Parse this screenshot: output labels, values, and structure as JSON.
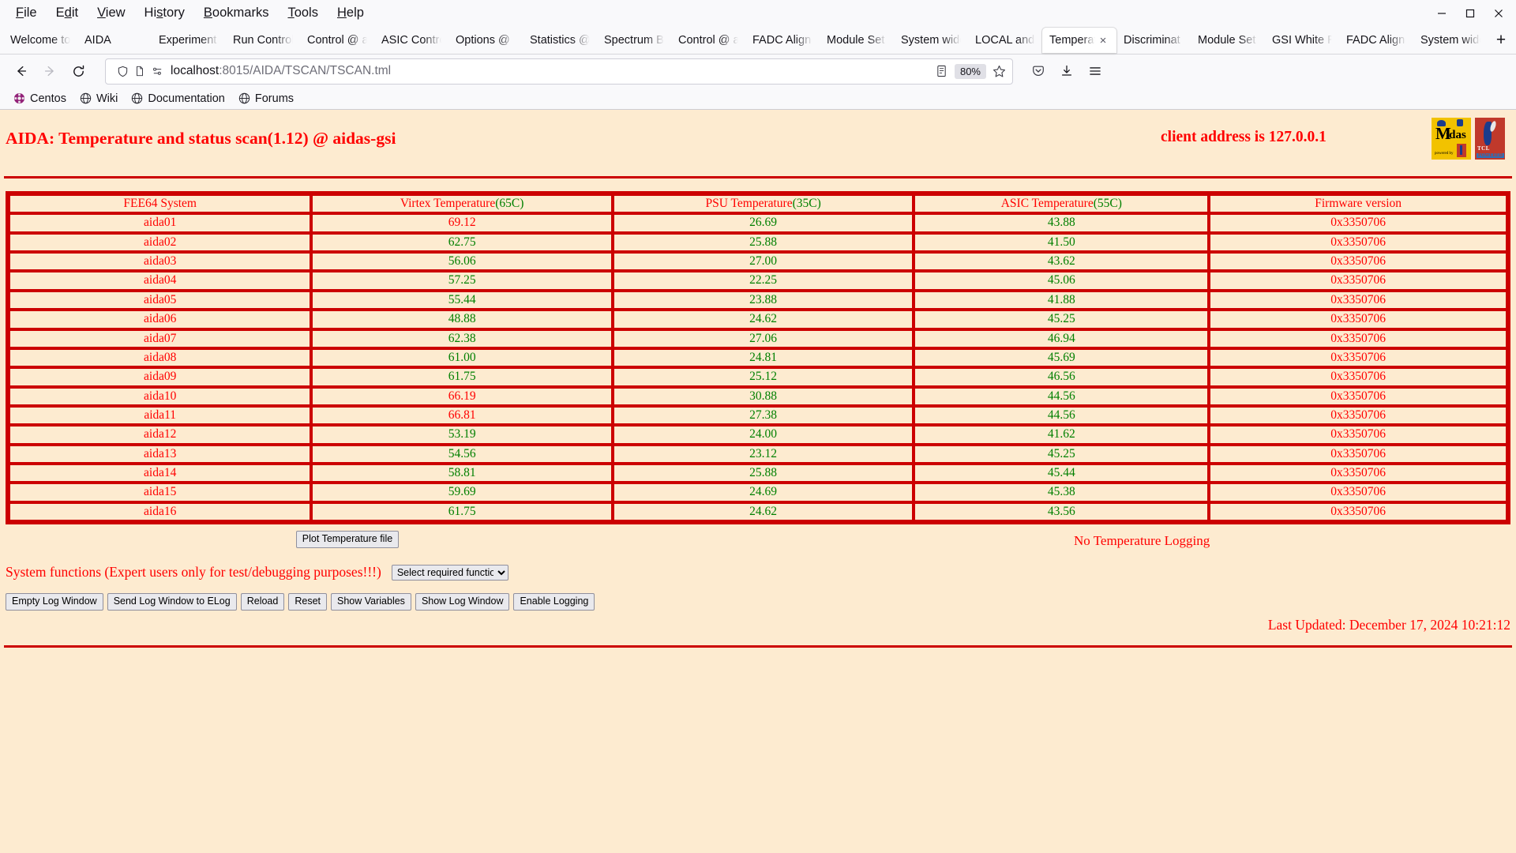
{
  "browser": {
    "menus": [
      "File",
      "Edit",
      "View",
      "History",
      "Bookmarks",
      "Tools",
      "Help"
    ],
    "window_controls": {
      "minimize": "minimize-icon",
      "maximize": "maximize-icon",
      "close": "close-icon"
    },
    "tabs": [
      {
        "label": "Welcome to Firefox",
        "active": false
      },
      {
        "label": "AIDA",
        "active": false
      },
      {
        "label": "Experiment",
        "active": false
      },
      {
        "label": "Run Control @",
        "active": false
      },
      {
        "label": "Control @ aidas",
        "active": false
      },
      {
        "label": "ASIC Control",
        "active": false
      },
      {
        "label": "Options @",
        "active": false
      },
      {
        "label": "Statistics @",
        "active": false
      },
      {
        "label": "Spectrum B",
        "active": false
      },
      {
        "label": "Control @ a",
        "active": false
      },
      {
        "label": "FADC Align",
        "active": false
      },
      {
        "label": "Module Set",
        "active": false
      },
      {
        "label": "System wide",
        "active": false
      },
      {
        "label": "LOCAL and",
        "active": false
      },
      {
        "label": "Temperature",
        "active": true
      },
      {
        "label": "Discriminat",
        "active": false
      },
      {
        "label": "Module Set",
        "active": false
      },
      {
        "label": "GSI White R",
        "active": false
      },
      {
        "label": "FADC Align",
        "active": false
      },
      {
        "label": "System wide",
        "active": false
      }
    ],
    "new_tab_label": "+",
    "nav": {
      "back": "back-arrow-icon",
      "forward": "forward-arrow-icon",
      "reload": "reload-icon"
    },
    "url_host": "localhost",
    "url_rest": ":8015/AIDA/TSCAN/TSCAN.tml",
    "zoom_level": "80%",
    "bookmarks": [
      {
        "label": "Centos",
        "icon": "centos-logo-icon"
      },
      {
        "label": "Wiki",
        "icon": "globe-icon"
      },
      {
        "label": "Documentation",
        "icon": "globe-icon"
      },
      {
        "label": "Forums",
        "icon": "globe-icon"
      }
    ]
  },
  "page": {
    "title": "AIDA: Temperature and status scan(1.12) @ aidas-gsi",
    "client_address": "client address is 127.0.0.1",
    "logos": {
      "midas": "midas-logo",
      "tcl": "tcl-powered-logo"
    },
    "table": {
      "headers": [
        {
          "text": "FEE64 System",
          "paren": ""
        },
        {
          "text": "Virtex Temperature",
          "paren": "(65C)"
        },
        {
          "text": "PSU Temperature",
          "paren": "(35C)"
        },
        {
          "text": "ASIC Temperature",
          "paren": "(55C)"
        },
        {
          "text": "Firmware version",
          "paren": ""
        }
      ],
      "rows": [
        {
          "system": "aida01",
          "virtex": "69.12",
          "virtex_hot": true,
          "psu": "26.69",
          "psu_hot": false,
          "asic": "43.88",
          "asic_hot": false,
          "firmware": "0x3350706"
        },
        {
          "system": "aida02",
          "virtex": "62.75",
          "virtex_hot": false,
          "psu": "25.88",
          "psu_hot": false,
          "asic": "41.50",
          "asic_hot": false,
          "firmware": "0x3350706"
        },
        {
          "system": "aida03",
          "virtex": "56.06",
          "virtex_hot": false,
          "psu": "27.00",
          "psu_hot": false,
          "asic": "43.62",
          "asic_hot": false,
          "firmware": "0x3350706"
        },
        {
          "system": "aida04",
          "virtex": "57.25",
          "virtex_hot": false,
          "psu": "22.25",
          "psu_hot": false,
          "asic": "45.06",
          "asic_hot": false,
          "firmware": "0x3350706"
        },
        {
          "system": "aida05",
          "virtex": "55.44",
          "virtex_hot": false,
          "psu": "23.88",
          "psu_hot": false,
          "asic": "41.88",
          "asic_hot": false,
          "firmware": "0x3350706"
        },
        {
          "system": "aida06",
          "virtex": "48.88",
          "virtex_hot": false,
          "psu": "24.62",
          "psu_hot": false,
          "asic": "45.25",
          "asic_hot": false,
          "firmware": "0x3350706"
        },
        {
          "system": "aida07",
          "virtex": "62.38",
          "virtex_hot": false,
          "psu": "27.06",
          "psu_hot": false,
          "asic": "46.94",
          "asic_hot": false,
          "firmware": "0x3350706"
        },
        {
          "system": "aida08",
          "virtex": "61.00",
          "virtex_hot": false,
          "psu": "24.81",
          "psu_hot": false,
          "asic": "45.69",
          "asic_hot": false,
          "firmware": "0x3350706"
        },
        {
          "system": "aida09",
          "virtex": "61.75",
          "virtex_hot": false,
          "psu": "25.12",
          "psu_hot": false,
          "asic": "46.56",
          "asic_hot": false,
          "firmware": "0x3350706"
        },
        {
          "system": "aida10",
          "virtex": "66.19",
          "virtex_hot": true,
          "psu": "30.88",
          "psu_hot": false,
          "asic": "44.56",
          "asic_hot": false,
          "firmware": "0x3350706"
        },
        {
          "system": "aida11",
          "virtex": "66.81",
          "virtex_hot": true,
          "psu": "27.38",
          "psu_hot": false,
          "asic": "44.56",
          "asic_hot": false,
          "firmware": "0x3350706"
        },
        {
          "system": "aida12",
          "virtex": "53.19",
          "virtex_hot": false,
          "psu": "24.00",
          "psu_hot": false,
          "asic": "41.62",
          "asic_hot": false,
          "firmware": "0x3350706"
        },
        {
          "system": "aida13",
          "virtex": "54.56",
          "virtex_hot": false,
          "psu": "23.12",
          "psu_hot": false,
          "asic": "45.25",
          "asic_hot": false,
          "firmware": "0x3350706"
        },
        {
          "system": "aida14",
          "virtex": "58.81",
          "virtex_hot": false,
          "psu": "25.88",
          "psu_hot": false,
          "asic": "45.44",
          "asic_hot": false,
          "firmware": "0x3350706"
        },
        {
          "system": "aida15",
          "virtex": "59.69",
          "virtex_hot": false,
          "psu": "24.69",
          "psu_hot": false,
          "asic": "45.38",
          "asic_hot": false,
          "firmware": "0x3350706"
        },
        {
          "system": "aida16",
          "virtex": "61.75",
          "virtex_hot": false,
          "psu": "24.62",
          "psu_hot": false,
          "asic": "43.56",
          "asic_hot": false,
          "firmware": "0x3350706"
        }
      ]
    },
    "plot_button": "Plot Temperature file",
    "logging_status": "No Temperature Logging",
    "system_functions_note": "System functions (Expert users only for test/debugging purposes!!!)",
    "function_select_value": "Select required function",
    "action_buttons": [
      "Empty Log Window",
      "Send Log Window to ELog",
      "Reload",
      "Reset",
      "Show Variables",
      "Show Log Window",
      "Enable Logging"
    ],
    "last_updated": "Last Updated: December 17, 2024 10:21:12",
    "colors": {
      "page_bg": "#FDEBD0",
      "red": "#FF0000",
      "border_red": "#cc0000",
      "green": "#008000"
    }
  }
}
